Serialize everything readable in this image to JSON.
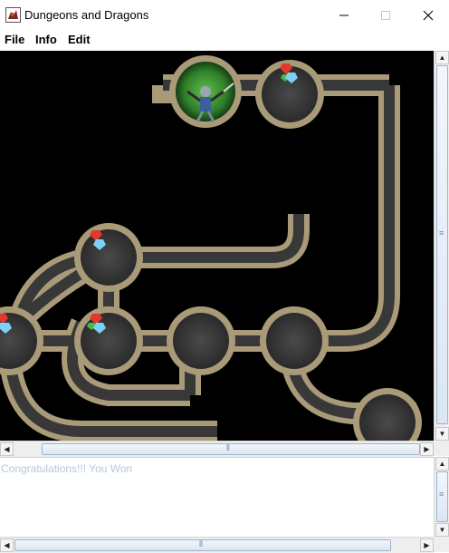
{
  "window": {
    "title": "Dungeons and Dragons",
    "controls": {
      "minimize_icon": "minimize-icon",
      "maximize_icon": "maximize-icon",
      "close_icon": "close-icon"
    }
  },
  "menu": {
    "items": [
      {
        "label": "File"
      },
      {
        "label": "Info"
      },
      {
        "label": "Edit"
      }
    ]
  },
  "game": {
    "board": "dungeon-map",
    "player": "hero-sprite",
    "treasure_icon": "gem-treasure-icon"
  },
  "message": {
    "text": "Congratulations!!! You Won"
  },
  "colors": {
    "background": "#000000",
    "stone_border": "#a99a78",
    "floor": "#3a3a3a",
    "message_text": "#b6c6dd",
    "highlight_glow": "#2f8f2f"
  }
}
